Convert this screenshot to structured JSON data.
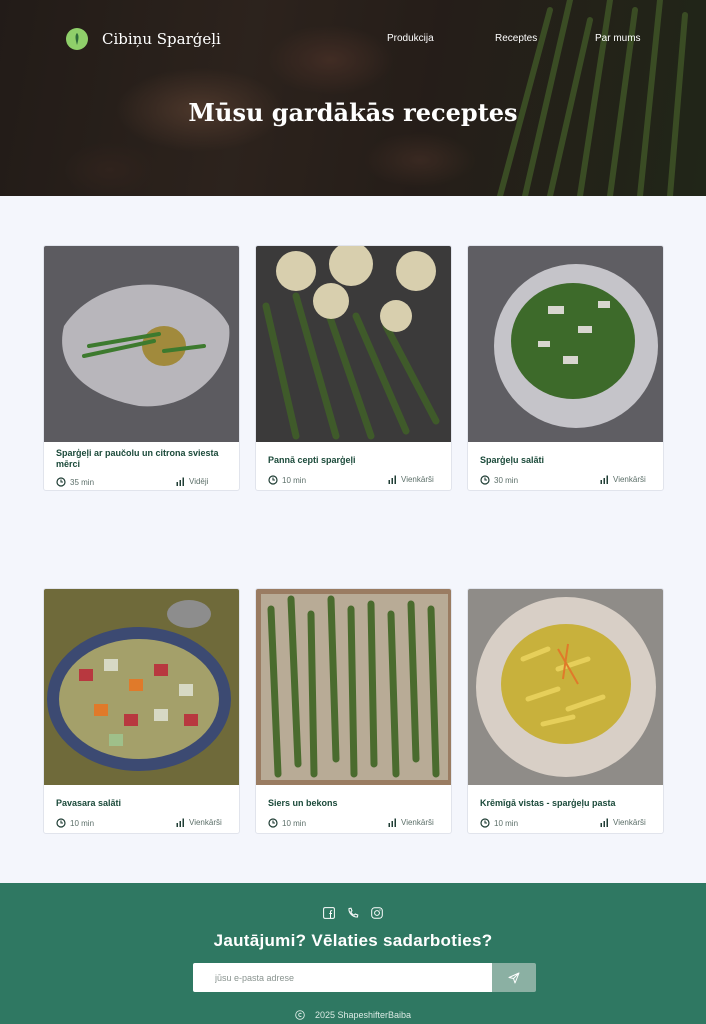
{
  "brand": {
    "name": "Cibiņu Sparģeļi",
    "logo_icon": "asparagus-logo-icon"
  },
  "nav": {
    "items": [
      "Produkcija",
      "Receptes",
      "Par mums"
    ]
  },
  "hero": {
    "title": "Mūsu gardākās receptes"
  },
  "recipes": [
    {
      "title": "Sparģeļi ar paučolu un citrona sviesta mērci",
      "time": "35 min",
      "difficulty": "Vidēji"
    },
    {
      "title": "Pannā cepti sparģeļi",
      "time": "10 min",
      "difficulty": "Vienkārši"
    },
    {
      "title": "Sparģeļu salāti",
      "time": "30 min",
      "difficulty": "Vienkārši"
    },
    {
      "title": "Pavasara salāti",
      "time": "10 min",
      "difficulty": "Vienkārši"
    },
    {
      "title": "Siers un bekons",
      "time": "10 min",
      "difficulty": "Vienkārši"
    },
    {
      "title": "Krēmīgā vistas - sparģeļu pasta",
      "time": "10 min",
      "difficulty": "Vienkārši"
    }
  ],
  "footer": {
    "heading": "Jautājumi? Vēlaties sadarboties?",
    "email_placeholder": "jūsu e-pasta adrese",
    "copyright": "2025 ShapeshifterBaiba",
    "icons": [
      "facebook-icon",
      "phone-icon",
      "instagram-icon"
    ]
  },
  "colors": {
    "footer": "#2f7862",
    "card_title": "#1b4a3a",
    "background": "#f4f6fc"
  }
}
